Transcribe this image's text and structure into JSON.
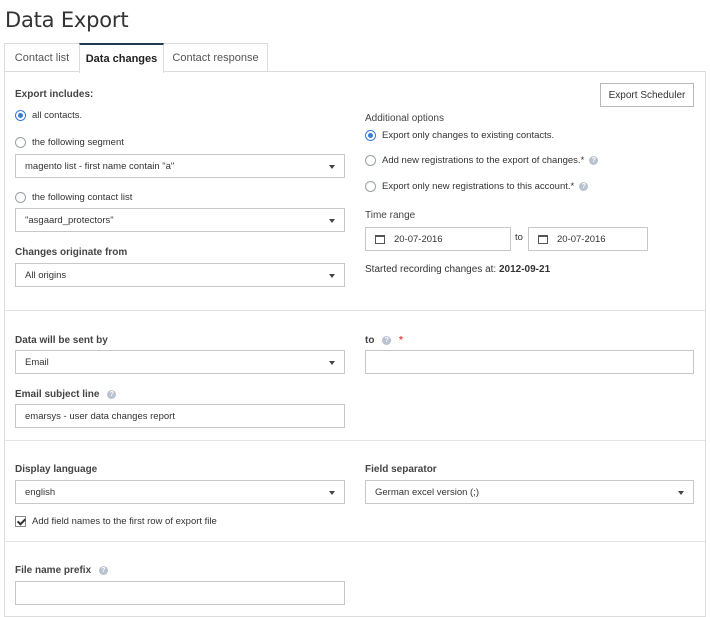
{
  "page": {
    "title": "Data Export"
  },
  "tabs": [
    {
      "label": "Contact list"
    },
    {
      "label": "Data changes"
    },
    {
      "label": "Contact response"
    }
  ],
  "export": {
    "scheduler_label": "Export Scheduler",
    "includes_label": "Export includes:",
    "opt_all": "all contacts.",
    "opt_segment": "the following segment",
    "segment_value": "magento list - first name contain \"a\"",
    "opt_contact_list": "the following contact list",
    "contact_list_value": "\"asgaard_protectors\"",
    "changes_label": "Changes originate from",
    "changes_value": "All origins"
  },
  "additional": {
    "label": "Additional options",
    "opt_existing": "Export only changes to existing contacts.",
    "opt_new_reg": "Add new registrations to the export of changes.*",
    "opt_only_new": "Export only new registrations to this account.*"
  },
  "time_range": {
    "label": "Time range",
    "from": "20-07-2016",
    "to_label": "to",
    "to": "20-07-2016",
    "started_text": "Started recording changes at:",
    "started_date": "2012-09-21"
  },
  "delivery": {
    "sent_by_label": "Data will be sent by",
    "sent_by_value": "Email",
    "to_label": "to",
    "to_required": "*",
    "to_value": "",
    "subject_label": "Email subject line",
    "subject_value": "emarsys - user data changes report"
  },
  "format": {
    "language_label": "Display language",
    "language_value": "english",
    "separator_label": "Field separator",
    "separator_value": "German excel version (;)",
    "field_names_label": "Add field names to the first row of export file"
  },
  "file": {
    "prefix_label": "File name prefix",
    "prefix_value": ""
  },
  "icons": {
    "help": "?",
    "calendar": "calendar-icon",
    "caret": "chevron-down-icon"
  },
  "colors": {
    "accent": "#3a7bd5",
    "active_tab": "#1f3a56",
    "required": "#e0474c"
  }
}
